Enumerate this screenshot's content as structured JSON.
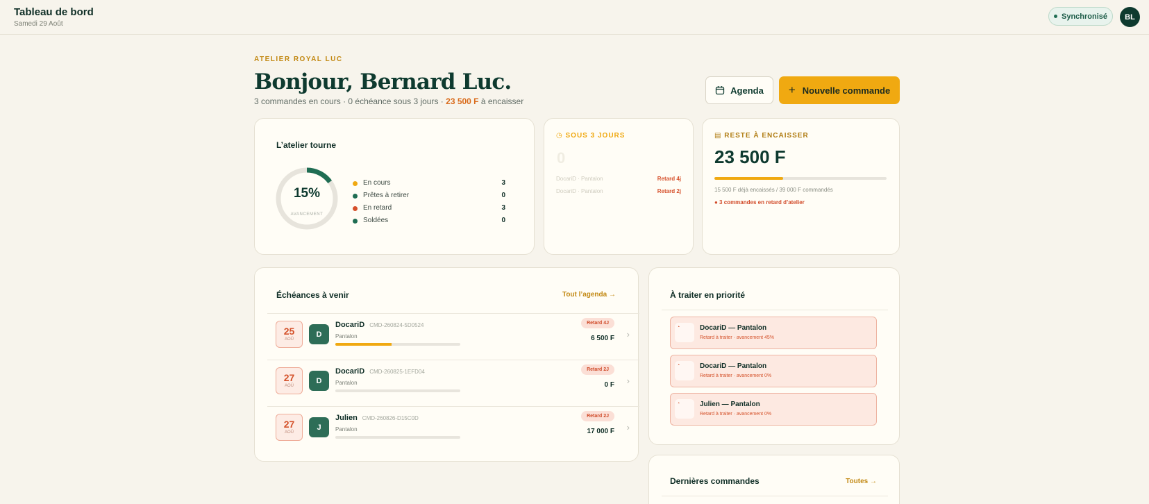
{
  "header": {
    "title": "Tableau de bord",
    "date": "Samedi 29 Août",
    "sync_label": "Synchronisé",
    "avatar_initials": "BL"
  },
  "hero": {
    "eyebrow": "ATELIER ROYAL LUC",
    "greeting": "Bonjour, Bernard Luc.",
    "summary_prefix": "3 commandes en cours · 0 échéance sous 3 jours · ",
    "summary_amount": "23 500 F",
    "summary_suffix": " à encaisser",
    "agenda_label": "Agenda",
    "new_order_label": "Nouvelle commande"
  },
  "atelier": {
    "title": "L’atelier tourne",
    "progress_percent": 15,
    "progress_label": "15%",
    "progress_caption": "AVANCEMENT",
    "legend": [
      {
        "name": "En cours",
        "value": "3",
        "color": "#f0a911"
      },
      {
        "name": "Prêtes à retirer",
        "value": "0",
        "color": "#1f6d53"
      },
      {
        "name": "En retard",
        "value": "3",
        "color": "#d6502b"
      },
      {
        "name": "Soldées",
        "value": "0",
        "color": "#1f6d53"
      }
    ]
  },
  "sous3": {
    "title": "SOUS 3 JOURS",
    "count": "0",
    "rows": [
      {
        "label": "DocariD · Pantalon",
        "late": "Retard 4j"
      },
      {
        "label": "DocariD · Pantalon",
        "late": "Retard 2j"
      }
    ]
  },
  "reste": {
    "title": "RESTE À ENCAISSER",
    "amount": "23 500 F",
    "paid_fraction": 0.4,
    "note": "15 500 F déjà encaissés / 39 000 F commandés",
    "warning": "● 3 commandes en retard d’atelier"
  },
  "echeances": {
    "title": "Échéances à venir",
    "link": "Tout l’agenda →",
    "rows": [
      {
        "day": "25",
        "month": "AOÛ",
        "initial": "D",
        "client": "DocariD",
        "ref": "CMD-260824-5D0524",
        "garment": "Pantalon",
        "progress": 0.45,
        "late": "Retard 4J",
        "price": "6 500 F"
      },
      {
        "day": "27",
        "month": "AOÛ",
        "initial": "D",
        "client": "DocariD",
        "ref": "CMD-260825-1EFD04",
        "garment": "Pantalon",
        "progress": 0,
        "late": "Retard 2J",
        "price": "0 F"
      },
      {
        "day": "27",
        "month": "AOÛ",
        "initial": "J",
        "client": "Julien",
        "ref": "CMD-260826-D15C0D",
        "garment": "Pantalon",
        "progress": 0,
        "late": "Retard 2J",
        "price": "17 000 F"
      }
    ]
  },
  "priorite": {
    "title": "À traiter en priorité",
    "items": [
      {
        "title": "DocariD — Pantalon",
        "subtitle": "Retard à traiter · avancement 45%"
      },
      {
        "title": "DocariD — Pantalon",
        "subtitle": "Retard à traiter · avancement 0%"
      },
      {
        "title": "Julien — Pantalon",
        "subtitle": "Retard à traiter · avancement 0%"
      }
    ]
  },
  "dernieres": {
    "title": "Dernières commandes",
    "link": "Toutes →"
  }
}
